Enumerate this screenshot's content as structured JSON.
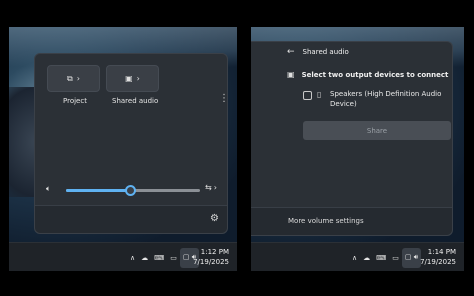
{
  "left": {
    "tiles": [
      {
        "label": "Project",
        "icon": "project-icon",
        "glyph": "⧉",
        "chevron": "›"
      },
      {
        "label": "Shared audio",
        "icon": "shared-audio-icon",
        "glyph": "▣",
        "chevron": "›"
      }
    ],
    "more_glyph": "⋮",
    "volume": {
      "icon_glyph": "🔈︎",
      "level": 0.48,
      "output_glyph": "⇆",
      "output_chevron": "›"
    },
    "settings_glyph": "⚙",
    "taskbar": {
      "chevron": "∧",
      "time": "1:12 PM",
      "date": "7/19/2025"
    }
  },
  "right": {
    "header": {
      "back_glyph": "←",
      "title": "Shared audio"
    },
    "instruction_glyph": "▣",
    "instruction": "Select two output devices to connect",
    "device": {
      "label_line1": "Speakers (High Definition Audio",
      "label_line2": "Device)",
      "icon_glyph": "▯"
    },
    "share_button": "Share",
    "footer_link": "More volume settings",
    "taskbar": {
      "chevron": "∧",
      "time": "1:14 PM",
      "date": "7/19/2025"
    }
  },
  "colors": {
    "accent": "#5fb2f2",
    "flyout_bg": "#2b3036",
    "taskbar_bg": "#1f2328"
  }
}
